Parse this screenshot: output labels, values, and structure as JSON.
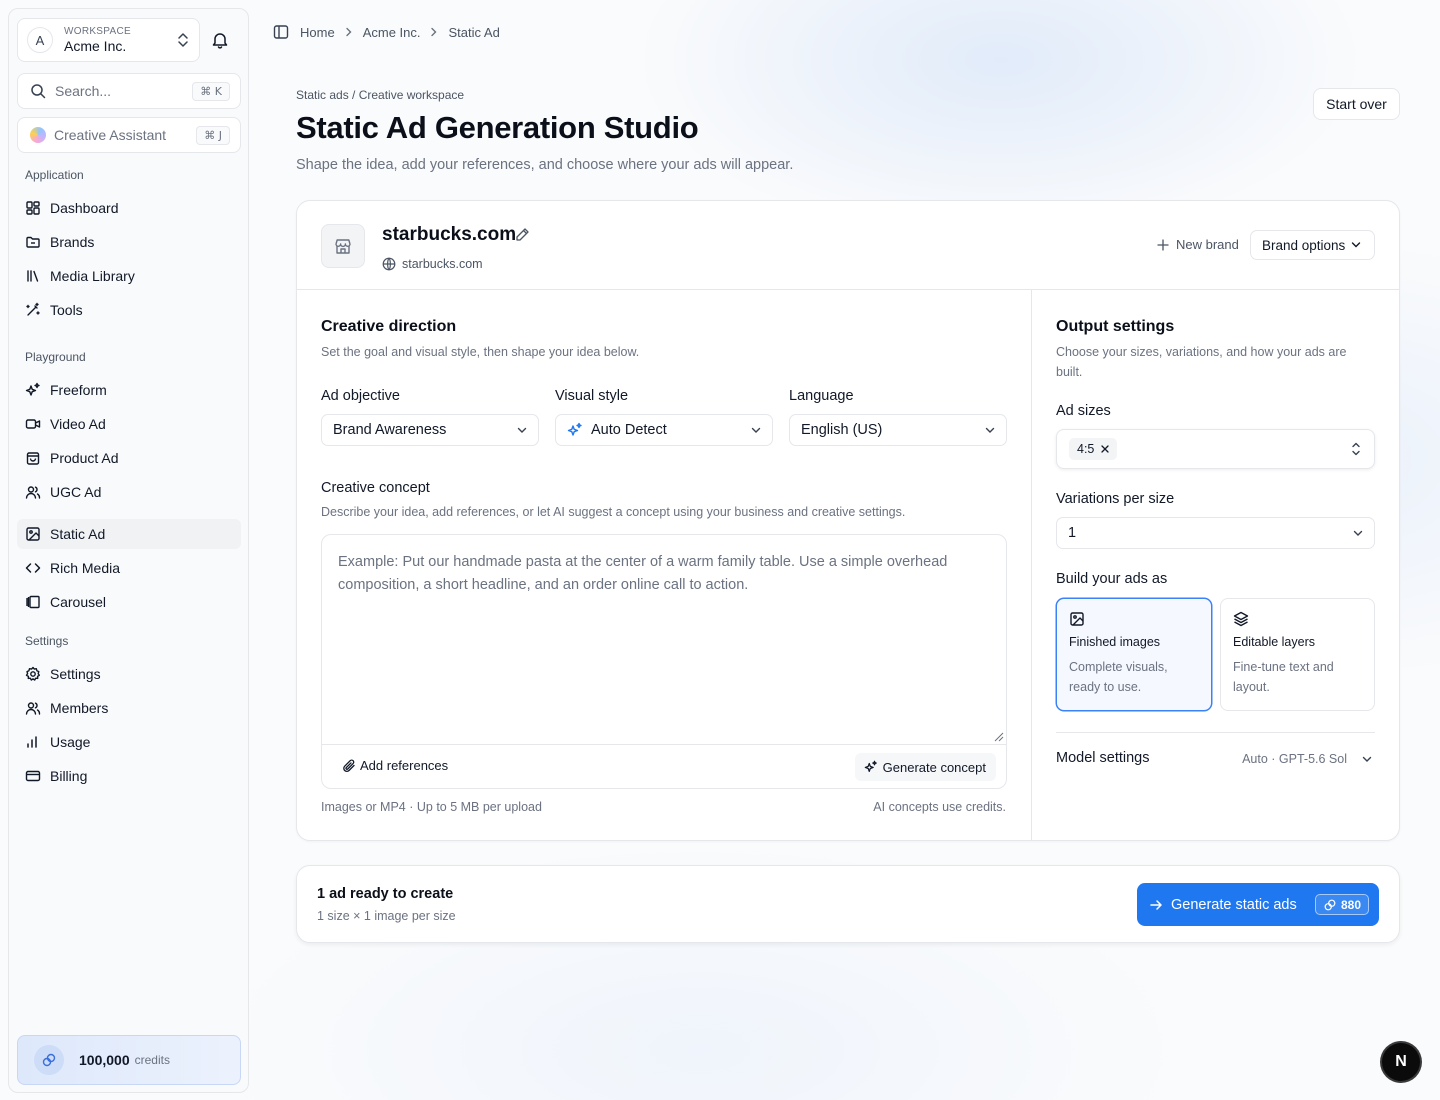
{
  "workspace": {
    "label": "WORKSPACE",
    "name": "Acme Inc.",
    "avatar_letter": "A"
  },
  "search": {
    "placeholder": "Search...",
    "shortcut": "⌘ K"
  },
  "assistant": {
    "label": "Creative Assistant",
    "shortcut": "⌘ J"
  },
  "sidebar": {
    "groups": [
      {
        "title": "Application",
        "items": [
          {
            "label": "Dashboard",
            "icon": "dashboard-icon"
          },
          {
            "label": "Brands",
            "icon": "folder-icon"
          },
          {
            "label": "Media Library",
            "icon": "library-icon"
          },
          {
            "label": "Tools",
            "icon": "wand-icon"
          }
        ]
      },
      {
        "title": "Playground",
        "items": [
          {
            "label": "Freeform",
            "icon": "sparkles-icon"
          },
          {
            "label": "Video Ad",
            "icon": "video-icon"
          },
          {
            "label": "Product Ad",
            "icon": "shopping-bag-icon"
          },
          {
            "label": "UGC Ad",
            "icon": "users-icon"
          },
          {
            "label": "Static Ad",
            "icon": "image-icon",
            "active": true
          },
          {
            "label": "Rich Media",
            "icon": "code-icon"
          },
          {
            "label": "Carousel",
            "icon": "carousel-icon"
          }
        ]
      },
      {
        "title": "Settings",
        "items": [
          {
            "label": "Settings",
            "icon": "gear-icon"
          },
          {
            "label": "Members",
            "icon": "users-icon"
          },
          {
            "label": "Usage",
            "icon": "bar-chart-icon"
          },
          {
            "label": "Billing",
            "icon": "credit-card-icon"
          }
        ]
      }
    ]
  },
  "credits": {
    "amount": "100,000",
    "label": "credits"
  },
  "breadcrumb": [
    "Home",
    "Acme Inc.",
    "Static Ad"
  ],
  "header": {
    "eyebrow": "Static ads / Creative workspace",
    "title": "Static Ad Generation Studio",
    "subtitle": "Shape the idea, add your references, and choose where your ads will appear.",
    "start_over": "Start over"
  },
  "brand": {
    "name": "starbucks.com",
    "url": "starbucks.com",
    "new_brand": "New brand",
    "options": "Brand options"
  },
  "creative": {
    "title": "Creative direction",
    "desc": "Set the goal and visual style, then shape your idea below.",
    "objective_label": "Ad objective",
    "objective_value": "Brand Awareness",
    "style_label": "Visual style",
    "style_value": "Auto Detect",
    "language_label": "Language",
    "language_value": "English (US)",
    "concept_label": "Creative concept",
    "concept_desc": "Describe your idea, add references, or let AI suggest a concept using your business and creative settings.",
    "concept_placeholder": "Example: Put our handmade pasta at the center of a warm family table. Use a simple overhead composition, a short headline, and an order online call to action.",
    "add_references": "Add references",
    "generate_concept": "Generate concept",
    "upload_note": "Images or MP4 · Up to 5 MB per upload",
    "credits_note": "AI concepts use credits."
  },
  "output": {
    "title": "Output settings",
    "desc": "Choose your sizes, variations, and how your ads are built.",
    "sizes_label": "Ad sizes",
    "sizes": [
      "4:5"
    ],
    "variations_label": "Variations per size",
    "variations_value": "1",
    "build_label": "Build your ads as",
    "build_options": [
      {
        "title": "Finished images",
        "desc": "Complete visuals, ready to use.",
        "selected": true
      },
      {
        "title": "Editable layers",
        "desc": "Fine-tune text and layout.",
        "selected": false
      }
    ],
    "model_label": "Model settings",
    "model_value": "Auto · GPT-5.6 Sol"
  },
  "summary": {
    "title": "1 ad ready to create",
    "sub": "1 size × 1 image per size",
    "cta": "Generate static ads",
    "cost": "880"
  },
  "dev_badge": "N",
  "colors": {
    "accent": "#1f78f0",
    "selected_border": "#3b82f6"
  }
}
